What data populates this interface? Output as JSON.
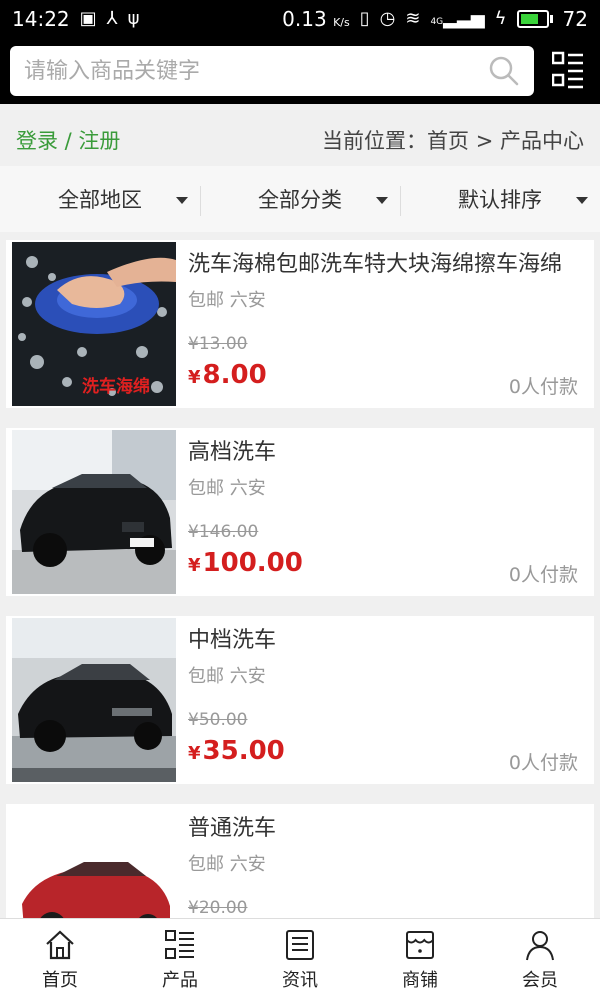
{
  "status": {
    "time": "14:22",
    "speed": "0.13",
    "speed_unit": "K/s",
    "battery": "72",
    "battery_level": 0.72,
    "signal_label": "4G"
  },
  "search": {
    "placeholder": "请输入商品关键字"
  },
  "crumb": {
    "login": "登录 / 注册",
    "position": "当前位置：首页 > 产品中心"
  },
  "filters": [
    {
      "label": "全部地区"
    },
    {
      "label": "全部分类"
    },
    {
      "label": "默认排序"
    }
  ],
  "products": [
    {
      "name": "洗车海棉包邮洗车特大块海绵擦车海绵",
      "shipping": "包邮",
      "location": "六安",
      "old_price": "¥13.00",
      "price": "8.00",
      "currency": "¥",
      "paid": "0人付款",
      "image_text": "洗车海绵"
    },
    {
      "name": "高档洗车",
      "shipping": "包邮",
      "location": "六安",
      "old_price": "¥146.00",
      "price": "100.00",
      "currency": "¥",
      "paid": "0人付款"
    },
    {
      "name": "中档洗车",
      "shipping": "包邮",
      "location": "六安",
      "old_price": "¥50.00",
      "price": "35.00",
      "currency": "¥",
      "paid": "0人付款"
    },
    {
      "name": "普通洗车",
      "shipping": "包邮",
      "location": "六安",
      "old_price": "¥20.00",
      "price": "",
      "currency": "",
      "paid": ""
    }
  ],
  "nav": [
    {
      "label": "首页",
      "icon": "home-icon"
    },
    {
      "label": "产品",
      "icon": "product-list-icon"
    },
    {
      "label": "资讯",
      "icon": "news-icon"
    },
    {
      "label": "商铺",
      "icon": "shop-icon"
    },
    {
      "label": "会员",
      "icon": "user-icon"
    }
  ]
}
